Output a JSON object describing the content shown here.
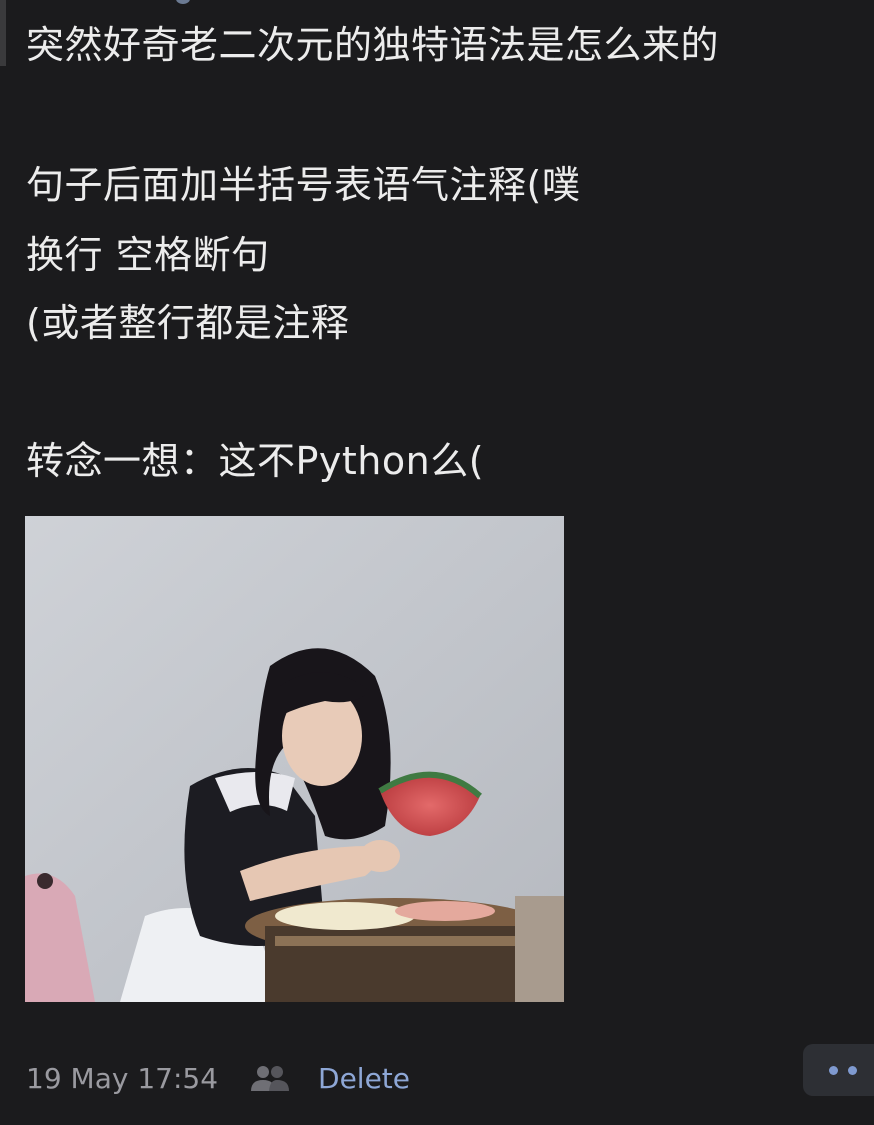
{
  "post": {
    "lines": [
      "突然好奇老二次元的独特语法是怎么来的",
      "句子后面加半括号表语气注释(噗",
      "换行 空格断句",
      "(或者整行都是注释",
      "转念一想：这不Python么("
    ]
  },
  "footer": {
    "timestamp": "19 May 17:54",
    "delete_label": "Delete"
  },
  "icons": {
    "audience": "people-icon",
    "more": "more-dots-icon"
  },
  "colors": {
    "background": "#1b1b1d",
    "text": "#ececec",
    "link": "#8ea7d6",
    "meta": "#9a9aa0"
  }
}
